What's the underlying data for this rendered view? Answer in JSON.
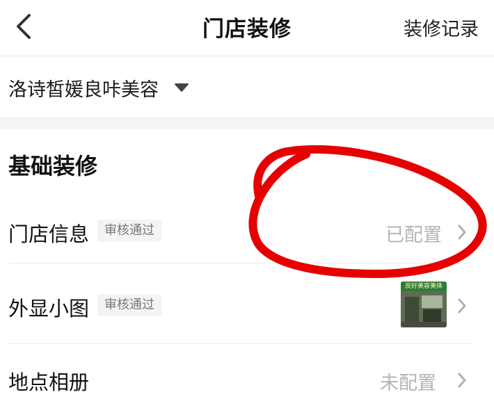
{
  "header": {
    "title": "门店装修",
    "action_label": "装修记录",
    "back_icon": "chevron-left-icon"
  },
  "store": {
    "name": "洛诗皙媛良咔美容",
    "caret_icon": "caret-down-icon"
  },
  "section": {
    "title": "基础装修"
  },
  "rows": [
    {
      "label": "门店信息",
      "badge": "审核通过",
      "status": "已配置"
    },
    {
      "label": "外显小图",
      "badge": "审核通过",
      "thumb_text": "良好美容美体"
    },
    {
      "label": "地点相册",
      "status": "未配置"
    }
  ],
  "annotation": {
    "shape": "hand-drawn-circle",
    "color": "#e60000"
  },
  "colors": {
    "divider": "#ececec",
    "status_text": "#b5b5b5",
    "badge_bg": "#f3f4f6"
  }
}
